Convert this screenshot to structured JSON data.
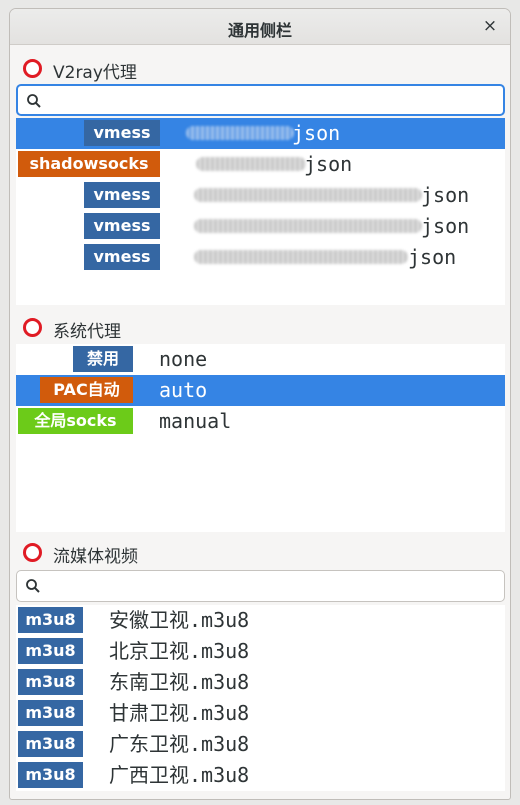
{
  "window": {
    "title": "通用侧栏",
    "close_glyph": "×"
  },
  "v2ray": {
    "heading": "V2ray代理",
    "search_placeholder": "",
    "items": [
      {
        "tag": "vmess",
        "text": "json",
        "selected": true
      },
      {
        "tag": "shadowsocks",
        "text": "json",
        "selected": false
      },
      {
        "tag": "vmess",
        "text": "json",
        "selected": false
      },
      {
        "tag": "vmess",
        "text": "json",
        "selected": false
      },
      {
        "tag": "vmess",
        "text": "json",
        "selected": false
      }
    ]
  },
  "system_proxy": {
    "heading": "系统代理",
    "items": [
      {
        "tag": "禁用",
        "text": "none",
        "selected": false
      },
      {
        "tag": "PAC自动",
        "text": "auto",
        "selected": true
      },
      {
        "tag": "全局socks",
        "text": "manual",
        "selected": false
      }
    ]
  },
  "streaming": {
    "heading": "流媒体视频",
    "search_placeholder": "",
    "items": [
      {
        "tag": "m3u8",
        "text": "安徽卫视.m3u8"
      },
      {
        "tag": "m3u8",
        "text": "北京卫视.m3u8"
      },
      {
        "tag": "m3u8",
        "text": "东南卫视.m3u8"
      },
      {
        "tag": "m3u8",
        "text": "甘肃卫视.m3u8"
      },
      {
        "tag": "m3u8",
        "text": "广东卫视.m3u8"
      },
      {
        "tag": "m3u8",
        "text": "广西卫视.m3u8"
      }
    ]
  },
  "colors": {
    "accent": "#3584e4",
    "tag_blue": "#3567a3",
    "tag_orange": "#d15b0c",
    "tag_green": "#6ccb19",
    "status_ring": "#e01b24"
  },
  "icons": {
    "search": "search-icon",
    "status": "red-ring-icon",
    "close": "close-icon"
  }
}
